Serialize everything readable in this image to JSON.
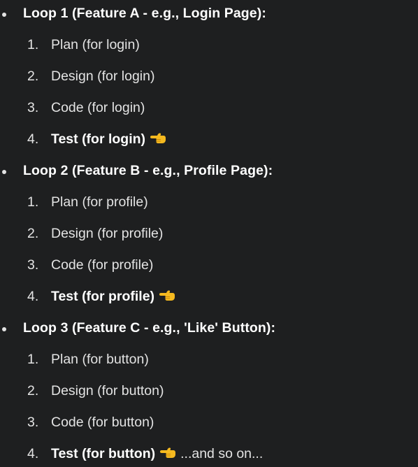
{
  "loops": [
    {
      "heading": "Loop 1 (Feature A - e.g., Login Page):",
      "steps": [
        {
          "num": "1.",
          "text": "Plan (for login)"
        },
        {
          "num": "2.",
          "text": "Design (for login)"
        },
        {
          "num": "3.",
          "text": "Code (for login)"
        },
        {
          "num": "4.",
          "text": "Test (for login)",
          "emoji": "backhand-index-pointing-left-icon"
        }
      ]
    },
    {
      "heading": "Loop 2 (Feature B - e.g., Profile Page):",
      "steps": [
        {
          "num": "1.",
          "text": "Plan (for profile)"
        },
        {
          "num": "2.",
          "text": "Design (for profile)"
        },
        {
          "num": "3.",
          "text": "Code (for profile)"
        },
        {
          "num": "4.",
          "text": "Test (for profile)",
          "emoji": "backhand-index-pointing-left-icon"
        }
      ]
    },
    {
      "heading": "Loop 3 (Feature C - e.g., 'Like' Button):",
      "steps": [
        {
          "num": "1.",
          "text": "Plan (for button)"
        },
        {
          "num": "2.",
          "text": "Design (for button)"
        },
        {
          "num": "3.",
          "text": "Code (for button)"
        },
        {
          "num": "4.",
          "text": "Test (for button)",
          "emoji": "backhand-index-pointing-left-icon",
          "trailer": "...and so on..."
        }
      ]
    }
  ],
  "colors": {
    "background": "#1e1f20",
    "text": "#e3e3e3",
    "bold_text": "#ffffff",
    "emoji_skin": "#f5b91f"
  }
}
